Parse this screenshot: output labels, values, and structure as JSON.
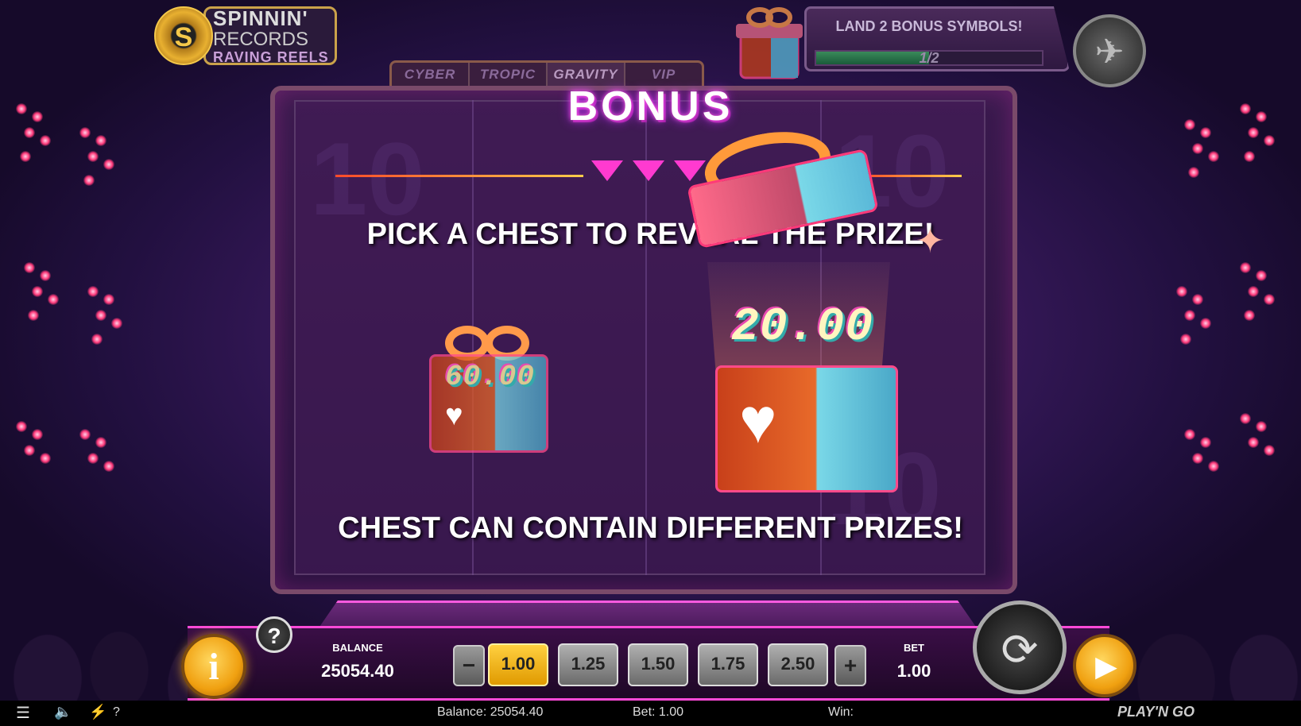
{
  "game": {
    "logo": {
      "line1": "SPINNIN'",
      "line2": "RECORDS",
      "line3": "RAVING REELS",
      "disc_letter": "S"
    },
    "modes": [
      {
        "label": "CYBER",
        "active": false
      },
      {
        "label": "TROPIC",
        "active": false
      },
      {
        "label": "GRAVITY",
        "active": true
      },
      {
        "label": "VIP",
        "active": false
      }
    ]
  },
  "bonus_meter": {
    "title": "LAND 2 BONUS SYMBOLS!",
    "count": "1/2",
    "progress": 0.5
  },
  "bonus": {
    "title": "BONUS",
    "pick_message": "PICK A CHEST TO REVEAL THE PRIZE!",
    "info_message": "CHEST CAN CONTAIN DIFFERENT PRIZES!",
    "chest_small_value": "60.00",
    "chest_large_value": "20.00"
  },
  "controls": {
    "balance_label": "BALANCE",
    "balance_value": "25054.40",
    "bet_label": "BET",
    "bet_value": "1.00",
    "bet_options": [
      {
        "label": "1.00",
        "selected": true
      },
      {
        "label": "1.25",
        "selected": false
      },
      {
        "label": "1.50",
        "selected": false
      },
      {
        "label": "1.75",
        "selected": false
      },
      {
        "label": "2.50",
        "selected": false
      }
    ],
    "minus_label": "−",
    "plus_label": "+",
    "info_label": "i",
    "help_label": "?"
  },
  "statusbar": {
    "balance": "Balance: 25054.40",
    "bet": "Bet: 1.00",
    "win": "Win:",
    "brand": "PLAY'N GO",
    "help": "?"
  },
  "icons": {
    "menu": "menu-icon",
    "sound": "speaker-icon",
    "turbo": "lightning-icon",
    "autoplay": "autoplay-icon",
    "spin": "play-icon",
    "turbo_mode": "airplane-icon"
  },
  "colors": {
    "accent": "#ff4ad8",
    "gold": "#f0a010",
    "bonus_glow": "#c02aff"
  }
}
